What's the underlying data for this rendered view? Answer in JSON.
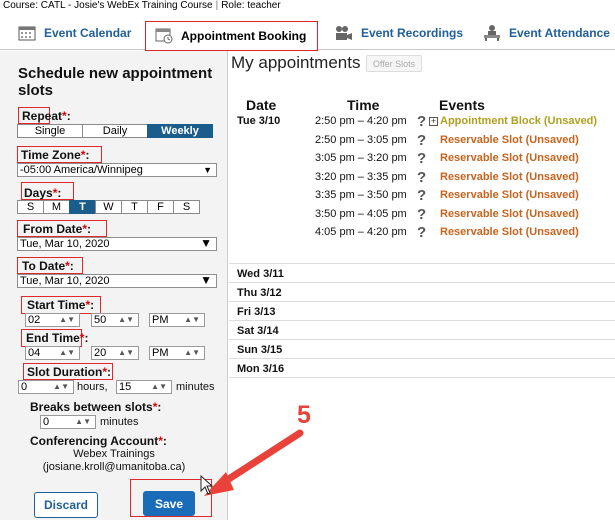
{
  "course_bar": {
    "course": "Course: CATL - Josie's WebEx Training Course",
    "role": "Role: teacher"
  },
  "tabs": [
    {
      "label": "Event Calendar",
      "icon": "calendar-icon",
      "active": false
    },
    {
      "label": "Appointment Booking",
      "icon": "appointment-icon",
      "active": true
    },
    {
      "label": "Event Recordings",
      "icon": "recording-icon",
      "active": false
    },
    {
      "label": "Event Attendance",
      "icon": "attendance-icon",
      "active": false
    }
  ],
  "form": {
    "title": "Schedule new appointment slots",
    "repeat": {
      "label": "Repeat",
      "options": [
        "Single",
        "Daily",
        "Weekly"
      ],
      "selected": "Weekly"
    },
    "time_zone": {
      "label": "Time Zone",
      "value": "-05:00 America/Winnipeg"
    },
    "days": {
      "label": "Days",
      "options": [
        "S",
        "M",
        "T",
        "W",
        "T",
        "F",
        "S"
      ],
      "selected_index": 2
    },
    "from_date": {
      "label": "From Date",
      "value": "Tue, Mar 10, 2020"
    },
    "to_date": {
      "label": "To Date",
      "value": "Tue, Mar 10, 2020"
    },
    "start_time": {
      "label": "Start Time",
      "hour": "02",
      "minute": "50",
      "ampm": "PM"
    },
    "end_time": {
      "label": "End Time",
      "hour": "04",
      "minute": "20",
      "ampm": "PM"
    },
    "slot_duration": {
      "label": "Slot Duration",
      "hours": "0",
      "hours_unit": "hours,",
      "minutes": "15",
      "minutes_unit": "minutes"
    },
    "breaks": {
      "label": "Breaks between slots",
      "value": "0",
      "unit": "minutes"
    },
    "conferencing": {
      "label": "Conferencing Account",
      "name": "Webex Trainings",
      "email": "(josiane.kroll@umanitoba.ca)"
    },
    "required_mark": "*",
    "colon": ":",
    "discard_label": "Discard",
    "save_label": "Save"
  },
  "appointments": {
    "title": "My appointments",
    "offer_slots_label": "Offer Slots",
    "headers": {
      "date": "Date",
      "time": "Time",
      "events": "Events"
    },
    "day_first": "Tue 3/10",
    "events": [
      {
        "time": "2:50 pm – 4:20 pm",
        "name": "Appointment Block (Unsaved)",
        "kind": "block"
      },
      {
        "time": "2:50 pm – 3:05 pm",
        "name": "Reservable Slot (Unsaved)",
        "kind": "slot"
      },
      {
        "time": "3:05 pm – 3:20 pm",
        "name": "Reservable Slot (Unsaved)",
        "kind": "slot"
      },
      {
        "time": "3:20 pm – 3:35 pm",
        "name": "Reservable Slot (Unsaved)",
        "kind": "slot"
      },
      {
        "time": "3:35 pm – 3:50 pm",
        "name": "Reservable Slot (Unsaved)",
        "kind": "slot"
      },
      {
        "time": "3:50 pm – 4:05 pm",
        "name": "Reservable Slot (Unsaved)",
        "kind": "slot"
      },
      {
        "time": "4:05 pm – 4:20 pm",
        "name": "Reservable Slot (Unsaved)",
        "kind": "slot"
      }
    ],
    "help_glyph": "?",
    "expand_glyph": "+",
    "other_days": [
      "Wed 3/11",
      "Thu 3/12",
      "Fri 3/13",
      "Sat 3/14",
      "Sun 3/15",
      "Mon 3/16"
    ]
  },
  "annotation": {
    "step_number": "5"
  },
  "colors": {
    "tab_blue": "#1f5f9a",
    "active_blue": "#1a5c8c",
    "save_blue": "#1a6cb8",
    "slot_orange": "#c8641e",
    "block_olive": "#b0a020",
    "annotation_red": "#e8423a"
  }
}
